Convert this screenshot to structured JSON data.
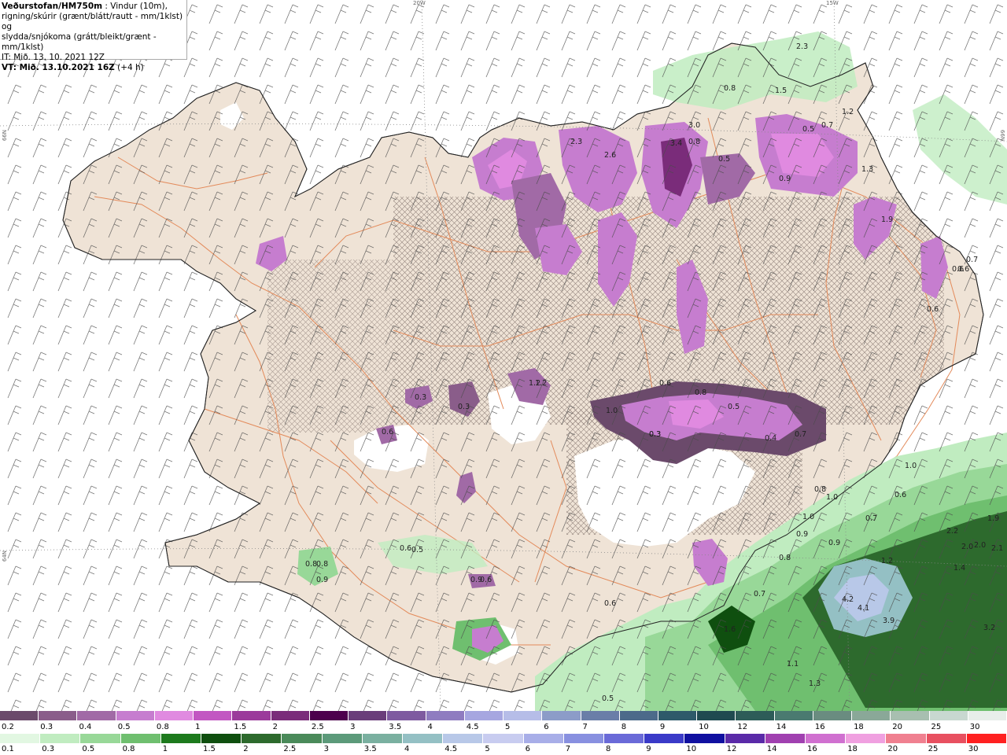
{
  "header": {
    "title": "Veðurstofan/HM750m",
    "title_suffix": " : Vindur (10m),",
    "line2": "rigning/skúrir (grænt/blátt/rautt - mm/1klst) og",
    "line3": "slydda/snjókoma (grátt/bleikt/grænt - mm/1klst)",
    "init_time": "IT: Mið. 13. 10. 2021 12Z",
    "valid_label": "VT: Mið. 13.10.2021 16Z",
    "valid_offset": " (+4 h)"
  },
  "grid_labels": {
    "lon_20w": "20W",
    "lon_15w": "15W",
    "lat_66n_left": "66N",
    "lat_66n_right": "66N",
    "lat_64n_left": "64N"
  },
  "value_labels": [
    {
      "text": "2.3"
    },
    {
      "text": "0.8"
    },
    {
      "text": "1.5"
    },
    {
      "text": "1.2"
    },
    {
      "text": "3.0"
    },
    {
      "text": "0.8"
    },
    {
      "text": "0.5"
    },
    {
      "text": "0.7"
    },
    {
      "text": "2.3"
    },
    {
      "text": "2.6"
    },
    {
      "text": "3.4"
    },
    {
      "text": "1.3"
    },
    {
      "text": "1.9"
    },
    {
      "text": "0.5"
    },
    {
      "text": "0.9"
    },
    {
      "text": "0.7"
    },
    {
      "text": "0.6"
    },
    {
      "text": "1.2"
    },
    {
      "text": "0.3"
    },
    {
      "text": "0.3"
    },
    {
      "text": "0.8"
    },
    {
      "text": "1.0"
    },
    {
      "text": "0.6"
    },
    {
      "text": "0.3"
    },
    {
      "text": "0.4"
    },
    {
      "text": "0.7"
    },
    {
      "text": "0.5"
    },
    {
      "text": "1.0"
    },
    {
      "text": "0.8"
    },
    {
      "text": "1.0"
    },
    {
      "text": "0.6"
    },
    {
      "text": "0.7"
    },
    {
      "text": "1.0"
    },
    {
      "text": "0.9"
    },
    {
      "text": "0.9"
    },
    {
      "text": "0.8"
    },
    {
      "text": "2.2"
    },
    {
      "text": "1.9"
    },
    {
      "text": "2.0"
    },
    {
      "text": "2.0"
    },
    {
      "text": "2.1"
    },
    {
      "text": "1.2"
    },
    {
      "text": "1.4"
    },
    {
      "text": "4.2"
    },
    {
      "text": "4.1"
    },
    {
      "text": "3.9"
    },
    {
      "text": "3.2"
    },
    {
      "text": "1.6"
    },
    {
      "text": "0.7"
    },
    {
      "text": "0.6"
    },
    {
      "text": "1.1"
    },
    {
      "text": "1.3"
    },
    {
      "text": "0.5"
    },
    {
      "text": "0.8"
    },
    {
      "text": "0.8"
    },
    {
      "text": "0.9"
    },
    {
      "text": "0.6"
    },
    {
      "text": "0.5"
    },
    {
      "text": "0.9"
    },
    {
      "text": "0.6"
    },
    {
      "text": "0.6"
    },
    {
      "text": "0.6"
    },
    {
      "text": "0.3"
    },
    {
      "text": "1.2"
    },
    {
      "text": "0.6"
    }
  ],
  "legend_snow": {
    "labels": [
      "0.2",
      "0.3",
      "0.4",
      "0.5",
      "0.8",
      "1",
      "1.5",
      "2",
      "2.5",
      "3",
      "3.5",
      "4",
      "4.5",
      "5",
      "6",
      "7",
      "8",
      "9",
      "10",
      "12",
      "14",
      "16",
      "18",
      "20",
      "25",
      "30"
    ],
    "colors": [
      "#6b4a6b",
      "#8a5d8a",
      "#a16aa6",
      "#c67dcf",
      "#e08ae0",
      "#c257c2",
      "#9b3a9b",
      "#7a2c7a",
      "#4d004d",
      "#6a3d7a",
      "#7e5aa0",
      "#8f7cc0",
      "#a6a6e0",
      "#b6bde8",
      "#8c9cc8",
      "#6a7ea8",
      "#4c6a8a",
      "#2e5a6a",
      "#1f4a50",
      "#2d5c58",
      "#4a7a70",
      "#6a8c80",
      "#8aa898",
      "#a8bfb0",
      "#c8d8d0",
      "#e8eeea"
    ]
  },
  "legend_rain": {
    "labels": [
      "0.1",
      "0.3",
      "0.5",
      "0.8",
      "1",
      "1.5",
      "2",
      "2.5",
      "3",
      "3.5",
      "4",
      "4.5",
      "5",
      "6",
      "7",
      "8",
      "9",
      "10",
      "12",
      "14",
      "16",
      "18",
      "20",
      "25",
      "30"
    ],
    "colors": [
      "#e2f7e2",
      "#c0ecc0",
      "#98d898",
      "#6fbf6f",
      "#1d7a1d",
      "#0f4f0f",
      "#2d6a2d",
      "#4a8a5a",
      "#5c9a7a",
      "#7ab0a0",
      "#94c0c4",
      "#b8c8e8",
      "#c8ccf0",
      "#a8aee8",
      "#8890e0",
      "#6a6ad8",
      "#3a3ac8",
      "#1010a0",
      "#5a2aa8",
      "#a040b0",
      "#d070d0",
      "#f0a0e0",
      "#f08090",
      "#e85060",
      "#ff2020"
    ]
  }
}
